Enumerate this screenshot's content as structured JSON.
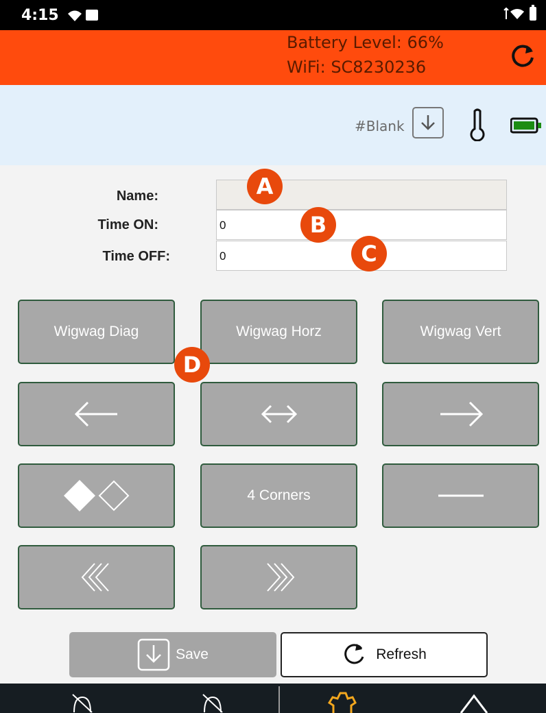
{
  "status_bar": {
    "time": "4:15"
  },
  "header": {
    "battery_level": "Battery Level: 66%",
    "wifi": "WiFi: SC8230236",
    "refresh_icon": "refresh-icon"
  },
  "subheader": {
    "pattern_name": "#Blank",
    "icons": [
      "download-icon",
      "thermometer-icon",
      "battery-icon"
    ],
    "battery_color": "#1c8c12"
  },
  "form": {
    "name_label": "Name:",
    "name_value": "",
    "time_on_label": "Time ON:",
    "time_on_value": "0",
    "time_off_label": "Time OFF:",
    "time_off_value": "0"
  },
  "badges": [
    "A",
    "B",
    "C",
    "D"
  ],
  "patterns": [
    {
      "label": "Wigwag Diag"
    },
    {
      "label": "Wigwag Horz"
    },
    {
      "label": "Wigwag Vert"
    },
    {
      "icon": "arrow-left-icon"
    },
    {
      "icon": "arrow-left-right-icon"
    },
    {
      "icon": "arrow-right-icon"
    },
    {
      "icon": "alternating-diamonds-icon"
    },
    {
      "label": "4 Corners"
    },
    {
      "icon": "horizontal-line-icon"
    },
    {
      "icon": "triple-chevron-left-icon"
    },
    {
      "icon": "triple-chevron-right-icon"
    }
  ],
  "actions": {
    "save_label": "Save",
    "refresh_label": "Refresh"
  },
  "colors": {
    "header_bg": "#ff4b0d",
    "subheader_bg": "#e3f0fb",
    "badge": "#e8490c",
    "button_bg": "#a8a8a8",
    "button_border": "#2f5b3d",
    "nav_bg": "#161d22",
    "nav_active": "#f3a71e"
  }
}
